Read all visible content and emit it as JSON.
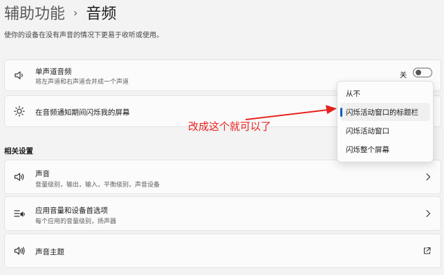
{
  "breadcrumb": {
    "parent": "辅助功能",
    "separator": "›",
    "current": "音频"
  },
  "page_description": "使你的设备在没有声音的情况下更易于收听或使用。",
  "mono_audio": {
    "icon": "speaker-icon",
    "title": "单声道音频",
    "description": "将左声道和右声道合并成一个声道",
    "toggle_state_label": "关"
  },
  "flash_screen": {
    "icon": "brightness-icon",
    "title": "在音频通知期间闪烁我的屏幕"
  },
  "dropdown": {
    "options": [
      {
        "label": "从不",
        "selected": false
      },
      {
        "label": "闪烁活动窗口的标题栏",
        "selected": true
      },
      {
        "label": "闪烁活动窗口",
        "selected": false
      },
      {
        "label": "闪烁整个屏幕",
        "selected": false
      }
    ]
  },
  "annotation": {
    "text": "改成这个就可以了",
    "color": "#e8211d"
  },
  "related_settings": {
    "heading": "相关设置",
    "items": [
      {
        "icon": "speaker-icon",
        "title": "声音",
        "description": "音量级别，输出，输入，平衡级别，声音设备",
        "action": "chevron-right-icon"
      },
      {
        "icon": "app-volume-icon",
        "title": "应用音量和设备首选项",
        "description": "每个应用的音量级别，扬声器",
        "action": "chevron-right-icon"
      },
      {
        "icon": "sound-theme-icon",
        "title": "声音主题",
        "description": "",
        "action": "external-link-icon"
      }
    ]
  },
  "colors": {
    "accent": "#005fb8",
    "background": "#f3f3f3",
    "card": "#fbfbfb"
  }
}
